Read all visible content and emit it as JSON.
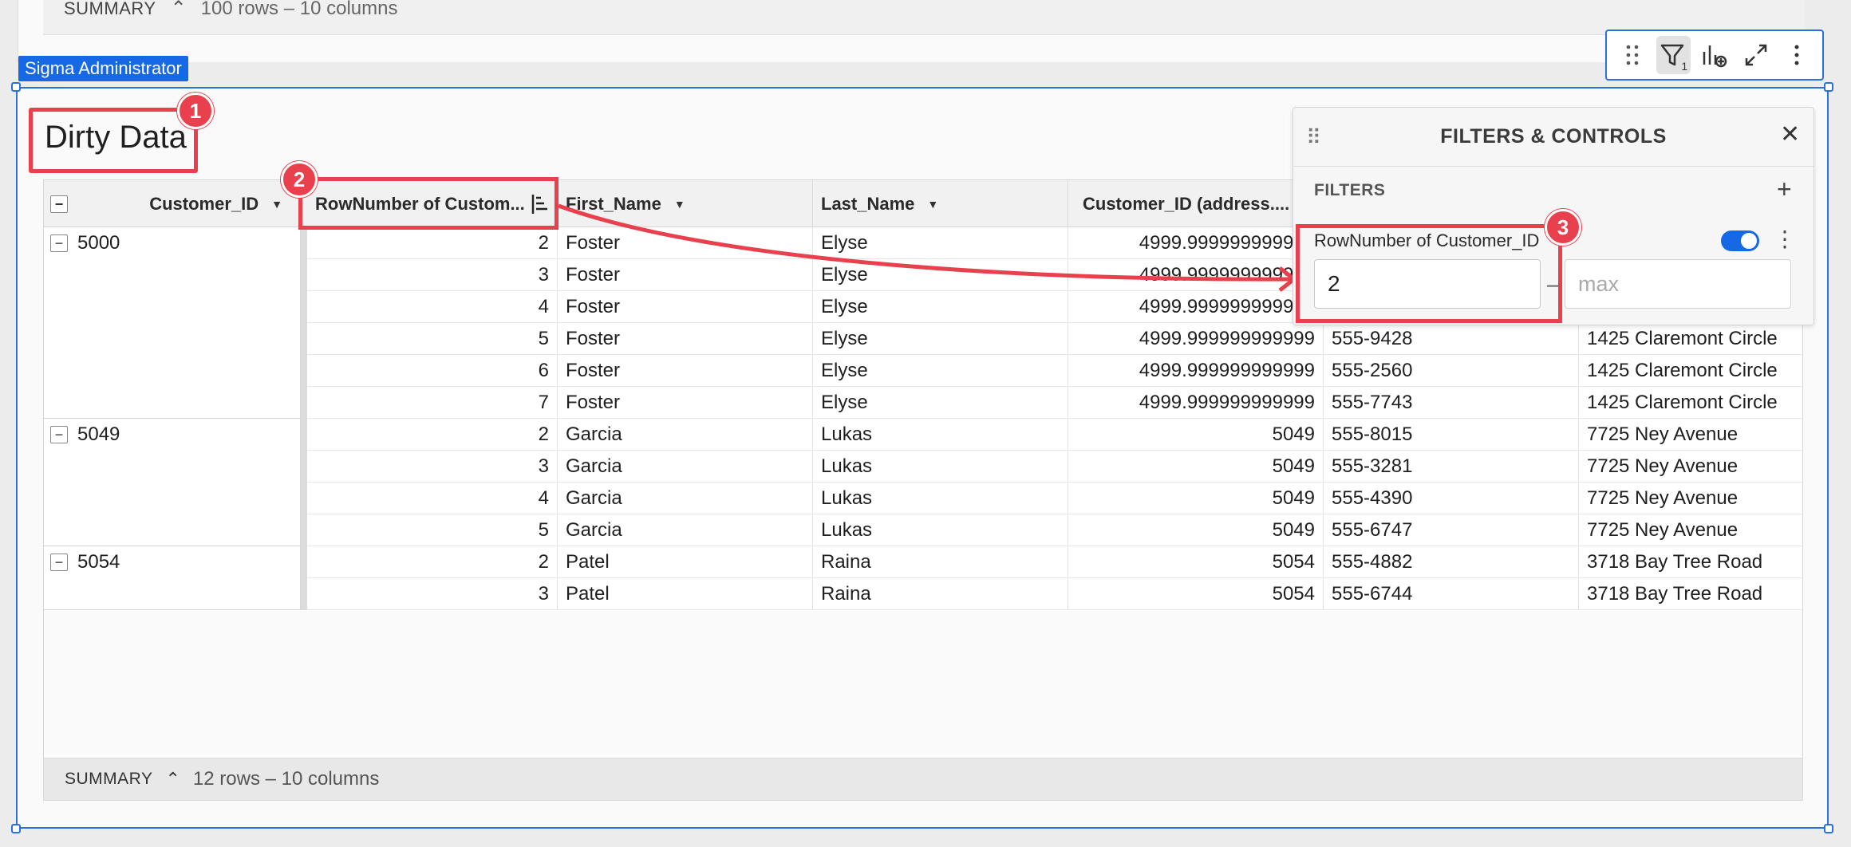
{
  "top_summary": {
    "label": "SUMMARY",
    "info": "100 rows – 10 columns"
  },
  "admin_badge": "Sigma Administrator",
  "toolbar": {
    "filter_count": "1",
    "icons": [
      "drag-handle-icon",
      "filter-icon",
      "add-chart-icon",
      "expand-icon",
      "more-icon"
    ]
  },
  "title": "Dirty Data",
  "callouts": [
    "1",
    "2",
    "3"
  ],
  "table": {
    "columns": [
      "Customer_ID",
      "RowNumber of Custom...",
      "First_Name",
      "Last_Name",
      "Customer_ID (address....",
      "",
      ""
    ],
    "groups": [
      {
        "id": "5000",
        "rows": [
          [
            "2",
            "Foster",
            "Elyse",
            "4999.999999999999",
            "",
            ""
          ],
          [
            "3",
            "Foster",
            "Elyse",
            "4999.999999999999",
            "",
            ""
          ],
          [
            "4",
            "Foster",
            "Elyse",
            "4999.999999999999",
            "",
            ""
          ],
          [
            "5",
            "Foster",
            "Elyse",
            "4999.999999999999",
            "555-9428",
            "1425 Claremont Circle"
          ],
          [
            "6",
            "Foster",
            "Elyse",
            "4999.999999999999",
            "555-2560",
            "1425 Claremont Circle"
          ],
          [
            "7",
            "Foster",
            "Elyse",
            "4999.999999999999",
            "555-7743",
            "1425 Claremont Circle"
          ]
        ]
      },
      {
        "id": "5049",
        "rows": [
          [
            "2",
            "Garcia",
            "Lukas",
            "5049",
            "555-8015",
            "7725 Ney Avenue"
          ],
          [
            "3",
            "Garcia",
            "Lukas",
            "5049",
            "555-3281",
            "7725 Ney Avenue"
          ],
          [
            "4",
            "Garcia",
            "Lukas",
            "5049",
            "555-4390",
            "7725 Ney Avenue"
          ],
          [
            "5",
            "Garcia",
            "Lukas",
            "5049",
            "555-6747",
            "7725 Ney Avenue"
          ]
        ]
      },
      {
        "id": "5054",
        "rows": [
          [
            "2",
            "Patel",
            "Raina",
            "5054",
            "555-4882",
            "3718 Bay Tree Road"
          ],
          [
            "3",
            "Patel",
            "Raina",
            "5054",
            "555-6744",
            "3718 Bay Tree Road"
          ]
        ]
      }
    ]
  },
  "summary": {
    "label": "SUMMARY",
    "info": "12 rows – 10 columns"
  },
  "filters_panel": {
    "title": "FILTERS & CONTROLS",
    "section": "FILTERS",
    "filter": {
      "label": "RowNumber of Customer_ID",
      "min_value": "2",
      "max_placeholder": "max",
      "separator": "–",
      "enabled": true
    }
  },
  "colors": {
    "accent": "#1768e5",
    "callout": "#e8414d",
    "selection": "#2b6fe0"
  }
}
